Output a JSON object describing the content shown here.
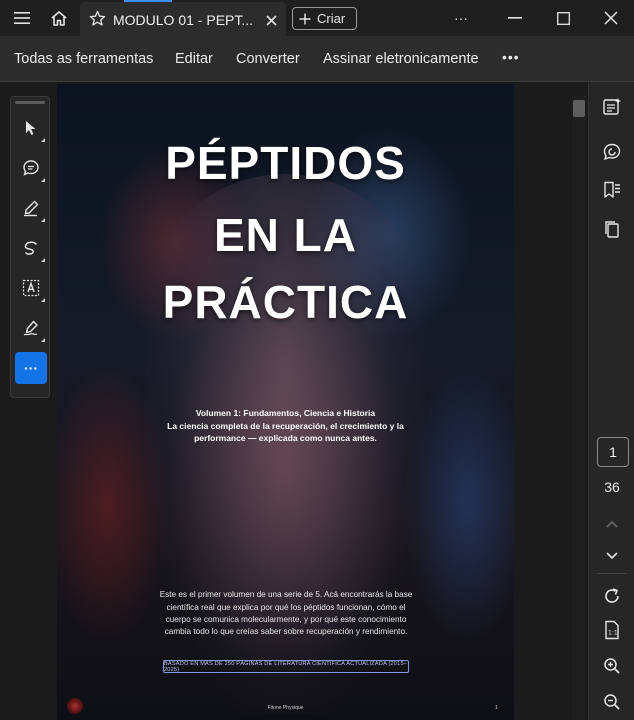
{
  "titlebar": {
    "tab_title": "MODULO 01 - PEPT...",
    "new_tab_label": "Criar",
    "more_label": "···"
  },
  "menubar": {
    "items": [
      "Todas as ferramentas",
      "Editar",
      "Converter",
      "Assinar eletronicamente"
    ],
    "more_label": "•••"
  },
  "toolbox": {
    "more_label": "···"
  },
  "document": {
    "title_lines": [
      "PÉPTIDOS",
      "EN LA",
      "PRÁCTICA"
    ],
    "subtitle_lines": [
      "Volumen 1: Fundamentos, Ciencia e Historia",
      "La ciencia completa de la recuperación, el crecimiento y la",
      "performance — explicada como nunca antes."
    ],
    "body_lines": [
      "Este es el primer volumen de una serie de 5. Acá encontrarás la base",
      "científica real que explica por qué los péptidos funcionan, cómo el",
      "cuerpo se comunica molecularmente, y por qué este conocimiento",
      "cambia todo lo que creías saber sobre recuperación y rendimiento."
    ],
    "badge": "BASADO EN MÁS DE 250 PÁGINAS DE LITERATURA CIENTÍFICA ACTUALIZADA (2015–2025)",
    "footer_brand": "Fitone Physique",
    "footer_page": "1"
  },
  "pager": {
    "current_page": "1",
    "total_pages": "36"
  },
  "colors": {
    "accent": "#1473e6",
    "tab_accent": "#3d8fff",
    "titlebar_bg": "#1f1f1f",
    "menubar_bg": "#2c2c2c"
  }
}
